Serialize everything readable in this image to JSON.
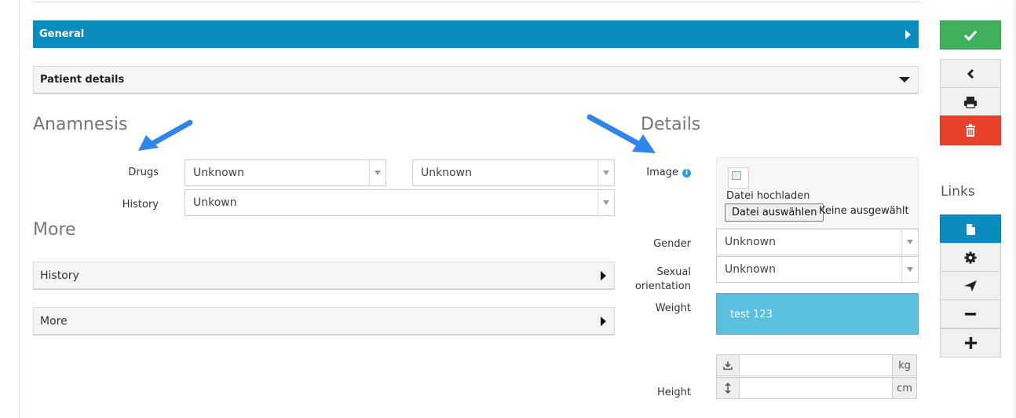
{
  "panels": {
    "general_label": "General",
    "patient_details_label": "Patient details"
  },
  "anamnesis": {
    "title": "Anamnesis",
    "drugs_label": "Drugs",
    "drugs_value_1": "Unknown",
    "drugs_value_2": "Unknown",
    "history_label": "History",
    "history_value": "Unkown"
  },
  "more": {
    "title": "More",
    "accordions": [
      {
        "label": "History"
      },
      {
        "label": "More"
      }
    ]
  },
  "details": {
    "title": "Details",
    "image_label": "Image",
    "upload_label": "Datei hochladen",
    "file_button_label": "Datei auswählen",
    "file_status": "Keine ausgewählt",
    "gender_label": "Gender",
    "gender_value": "Unknown",
    "sexual_orientation_label_line1": "Sexual",
    "sexual_orientation_label_line2": "orientation",
    "sexual_orientation_value": "Unknown",
    "weight_label": "Weight",
    "weight_value": "test 123",
    "weight_unit": "kg",
    "height_label": "Height",
    "height_unit": "cm"
  },
  "sidebar": {
    "links_title": "Links"
  },
  "icons": {
    "general_toggle": "caret-right-icon",
    "patient_toggle": "caret-down-icon",
    "save": "check-icon",
    "back": "chevron-left-icon",
    "print": "print-icon",
    "delete": "trash-icon",
    "document": "file-icon",
    "settings": "gear-icon",
    "send": "send-icon",
    "minus": "minus-icon",
    "plus": "plus-icon",
    "info": "info-icon",
    "weight_addon": "download-icon",
    "height_addon": "vertical-arrows-icon"
  },
  "colors": {
    "primary": "#0a8cbf",
    "success": "#3fb05a",
    "danger": "#e8432a",
    "info": "#5bc0de",
    "annotation_arrow": "#2f86e8"
  }
}
